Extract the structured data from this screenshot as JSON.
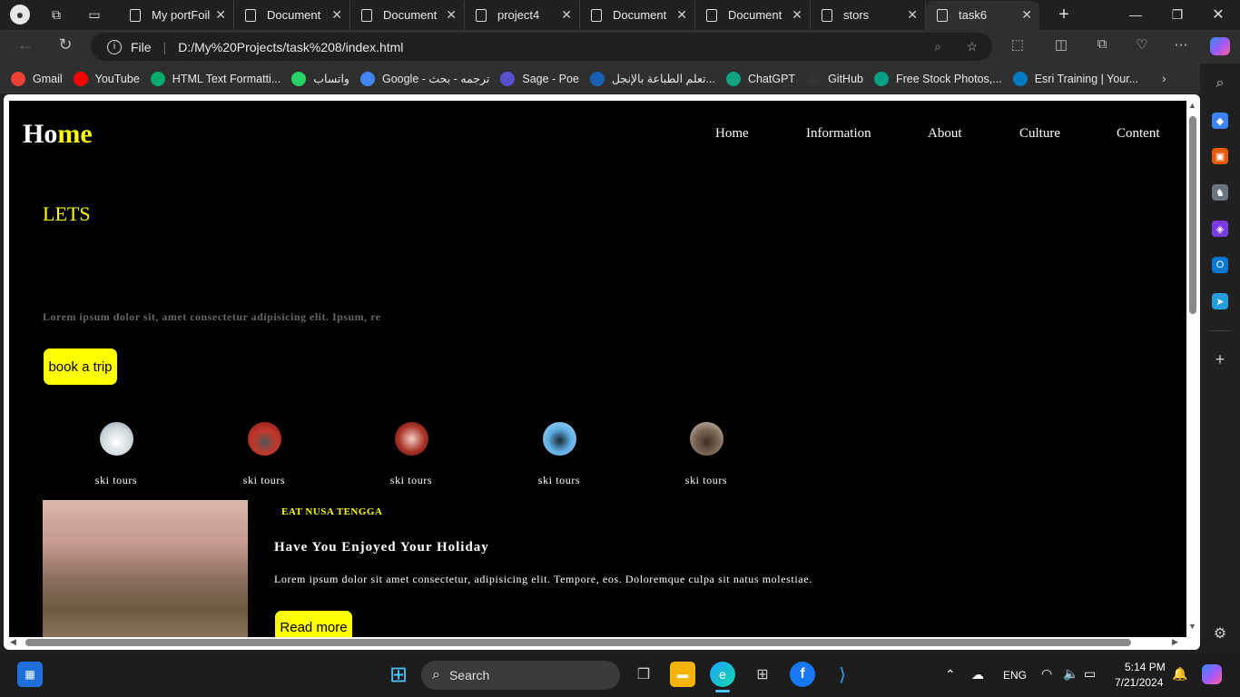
{
  "browser": {
    "tabs": [
      {
        "label": "My portFoili"
      },
      {
        "label": "Document"
      },
      {
        "label": "Document"
      },
      {
        "label": "project4"
      },
      {
        "label": "Document"
      },
      {
        "label": "Document"
      },
      {
        "label": "stors"
      },
      {
        "label": "task6"
      }
    ],
    "address": {
      "prefix": "File",
      "url": "D:/My%20Projects/task%208/index.html"
    },
    "bookmarks": [
      {
        "label": "Gmail",
        "color": "#ea4335"
      },
      {
        "label": "YouTube",
        "color": "#ff0000"
      },
      {
        "label": "HTML Text Formatti...",
        "color": "#04aa6d"
      },
      {
        "label": "واتساب",
        "color": "#25d366"
      },
      {
        "label": "Google - ترجمه - بحث",
        "color": "#4285f4"
      },
      {
        "label": "Sage - Poe",
        "color": "#5a4fcf"
      },
      {
        "label": "تعلم الطباعة بالإنجل...",
        "color": "#1a5fb4"
      },
      {
        "label": "ChatGPT",
        "color": "#10a37f"
      },
      {
        "label": "GitHub",
        "color": "#333333"
      },
      {
        "label": "Free Stock Photos,...",
        "color": "#05a081"
      },
      {
        "label": "Esri Training | Your...",
        "color": "#007ac2"
      }
    ]
  },
  "site": {
    "logo_a": "Ho",
    "logo_b": "me",
    "nav": [
      "Home",
      "Information",
      "About",
      "Culture",
      "Content"
    ],
    "hero_title": "LETS",
    "hero_text": "Lorem ipsum dolor sit, amet consectetur adipisicing elit. Ipsum, re",
    "book_button": "book a trip",
    "tours": [
      {
        "label": "ski tours",
        "color": "#dfe6e9"
      },
      {
        "label": "ski tours",
        "color": "#c0392b"
      },
      {
        "label": "ski tours",
        "color": "#a93226"
      },
      {
        "label": "ski tours",
        "color": "#5dade2"
      },
      {
        "label": "ski tours",
        "color": "#7f6a58"
      }
    ],
    "card": {
      "eyebrow": "EAT NUSA TENGGA",
      "title": "Have You Enjoyed Your Holiday",
      "text": "Lorem ipsum dolor sit amet consectetur, adipisicing elit. Tempore, eos. Doloremque culpa sit natus molestiae.",
      "button": "Read more"
    }
  },
  "taskbar": {
    "search_placeholder": "Search",
    "lang": "ENG",
    "time": "5:14 PM",
    "date": "7/21/2024"
  },
  "colors": {
    "accent": "#ffff00",
    "page_bg": "#000000"
  }
}
